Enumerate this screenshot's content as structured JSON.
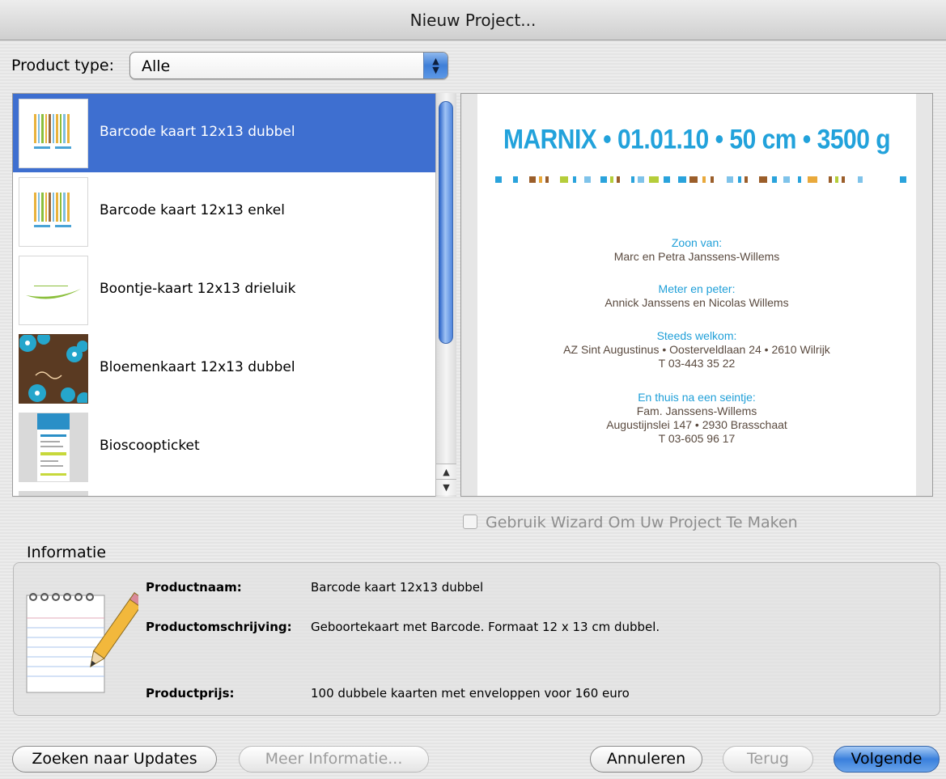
{
  "window": {
    "title": "Nieuw Project..."
  },
  "product_type": {
    "label": "Product type:",
    "value": "Alle"
  },
  "products": [
    {
      "label": "Barcode kaart 12x13 dubbel",
      "selected": true,
      "icon": "barcode-thumbnail-icon"
    },
    {
      "label": "Barcode kaart 12x13 enkel",
      "selected": false,
      "icon": "barcode-thumbnail-icon"
    },
    {
      "label": "Boontje-kaart 12x13 drieluik",
      "selected": false,
      "icon": "bean-card-thumbnail-icon"
    },
    {
      "label": "Bloemenkaart 12x13 dubbel",
      "selected": false,
      "icon": "flower-card-thumbnail-icon"
    },
    {
      "label": "Bioscoopticket",
      "selected": false,
      "icon": "cinema-ticket-thumbnail-icon"
    }
  ],
  "preview": {
    "title": "MARNIX • 01.01.10 • 50 cm • 3500 g",
    "blocks": [
      {
        "heading": "Zoon van:",
        "lines": [
          "Marc en Petra Janssens-Willems"
        ]
      },
      {
        "heading": "Meter en peter:",
        "lines": [
          "Annick Janssens en Nicolas Willems"
        ]
      },
      {
        "heading": "Steeds welkom:",
        "lines": [
          "AZ Sint Augustinus • Oosterveldlaan 24 • 2610 Wilrijk",
          "T 03-443 35 22"
        ]
      },
      {
        "heading": "En thuis na een seintje:",
        "lines": [
          "Fam. Janssens-Willems",
          "Augustijnslei 147 • 2930 Brasschaat",
          "T 03-605 96 17"
        ]
      }
    ],
    "accent_color": "#22a2db",
    "text_color": "#5a4a3f"
  },
  "wizard": {
    "label": "Gebruik Wizard Om Uw Project Te Maken",
    "checked": false,
    "enabled": false
  },
  "info": {
    "heading": "Informatie",
    "name_label": "Productnaam:",
    "name_value": "Barcode kaart 12x13 dubbel",
    "desc_label": "Productomschrijving:",
    "desc_value": "Geboortekaart met Barcode. Formaat 12 x 13 cm dubbel.",
    "price_label": "Productprijs:",
    "price_value": "100 dubbele kaarten met enveloppen voor 160 euro"
  },
  "buttons": {
    "updates": "Zoeken naar Updates",
    "more_info": "Meer Informatie...",
    "cancel": "Annuleren",
    "back": "Terug",
    "next": "Volgende"
  }
}
